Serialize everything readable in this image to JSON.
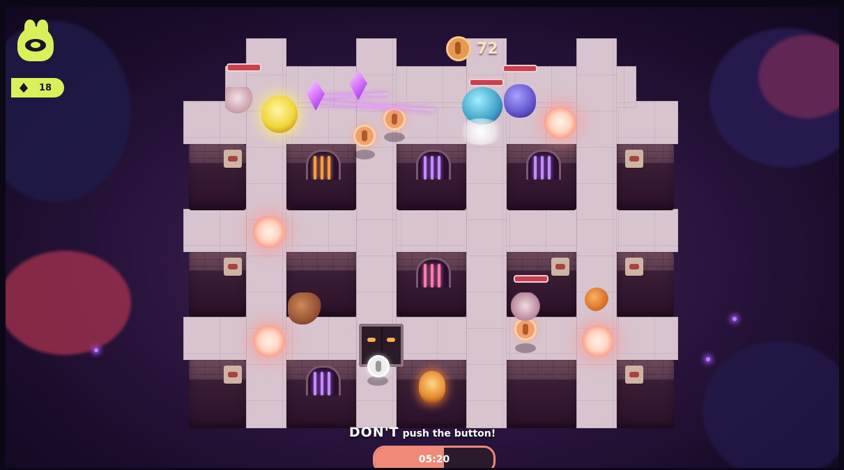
{
  "hud": {
    "player_icon": "alien-blob-icon",
    "gem_icon": "gem-icon",
    "gem_count": "18",
    "coin_icon": "coin-icon",
    "coin_count": "72"
  },
  "objective": {
    "emphasis": "DON'T",
    "rest": "push the button!"
  },
  "timer": {
    "time": "05:20",
    "progress": 0.58
  },
  "colors": {
    "accent_lime": "#d9f05a",
    "timer_fill": "#f08a78",
    "health_red": "#c9404f",
    "crystal_purple": "#d36bff"
  }
}
